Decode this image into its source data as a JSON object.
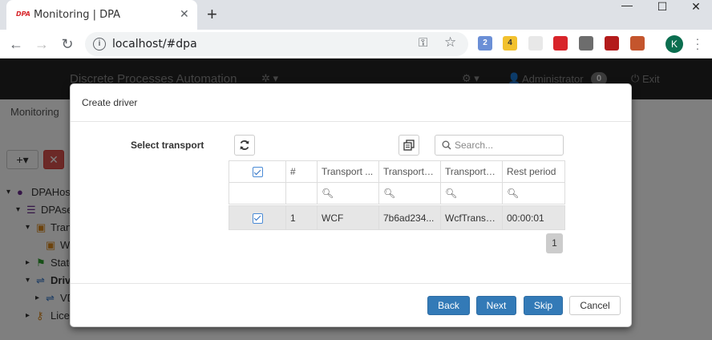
{
  "browser": {
    "tab_title": "Monitoring | DPA",
    "tab_favicon_text": "DPA",
    "url": "localhost/#dpa",
    "extensions": [
      {
        "name": "mail-extension",
        "badge": "2",
        "color": "#6b8fd6"
      },
      {
        "name": "counter-extension",
        "badge": "4",
        "color": "#f2c12e"
      },
      {
        "name": "feather-extension",
        "badge": "",
        "color": "#e8e8e8"
      },
      {
        "name": "adblock-extension",
        "badge": "",
        "color": "#d8242a"
      },
      {
        "name": "circle-extension",
        "badge": "",
        "color": "#6d6d6d"
      },
      {
        "name": "pdf-extension",
        "badge": "",
        "color": "#b31b1b"
      },
      {
        "name": "person-extension",
        "badge": "",
        "color": "#c4552d"
      }
    ],
    "profile_initial": "K"
  },
  "app": {
    "brand": "Discrete Processes Automation",
    "user": "Administrator",
    "badge_count": "0",
    "exit_label": "Exit",
    "breadcrumb": "Monitoring",
    "tree": [
      {
        "label": "DPAHost",
        "indent": 0,
        "icon": "globe-icon",
        "icon_color": "#6a2d8f"
      },
      {
        "label": "DPAserver",
        "indent": 1,
        "icon": "server-icon",
        "icon_color": "#6a2d8f"
      },
      {
        "label": "Transports",
        "indent": 2,
        "icon": "bus-icon",
        "icon_color": "#d9861a"
      },
      {
        "label": "WCF",
        "indent": 3,
        "icon": "bus-icon",
        "icon_color": "#d9861a"
      },
      {
        "label": "States",
        "indent": 2,
        "icon": "flag-icon",
        "icon_color": "#2f9e2f"
      },
      {
        "label": "Drivers",
        "indent": 2,
        "icon": "usb-icon",
        "icon_color": "#2a6fc4"
      },
      {
        "label": "VDriver",
        "indent": 3,
        "icon": "usb-icon",
        "icon_color": "#2a6fc4"
      },
      {
        "label": "Licenses",
        "indent": 2,
        "icon": "key-icon",
        "icon_color": "#d9861a"
      }
    ]
  },
  "modal": {
    "title": "Create driver",
    "field_label": "Select transport",
    "search_placeholder": "Search...",
    "columns": [
      "#",
      "Transport ...",
      "Transport i...",
      "Transport t...",
      "Rest period"
    ],
    "rows": [
      {
        "checked": true,
        "num": "1",
        "name": "WCF",
        "id": "7b6ad234...",
        "type": "WcfTransp...",
        "rest": "00:00:01"
      }
    ],
    "page": "1",
    "buttons": {
      "back": "Back",
      "next": "Next",
      "skip": "Skip",
      "cancel": "Cancel"
    }
  }
}
